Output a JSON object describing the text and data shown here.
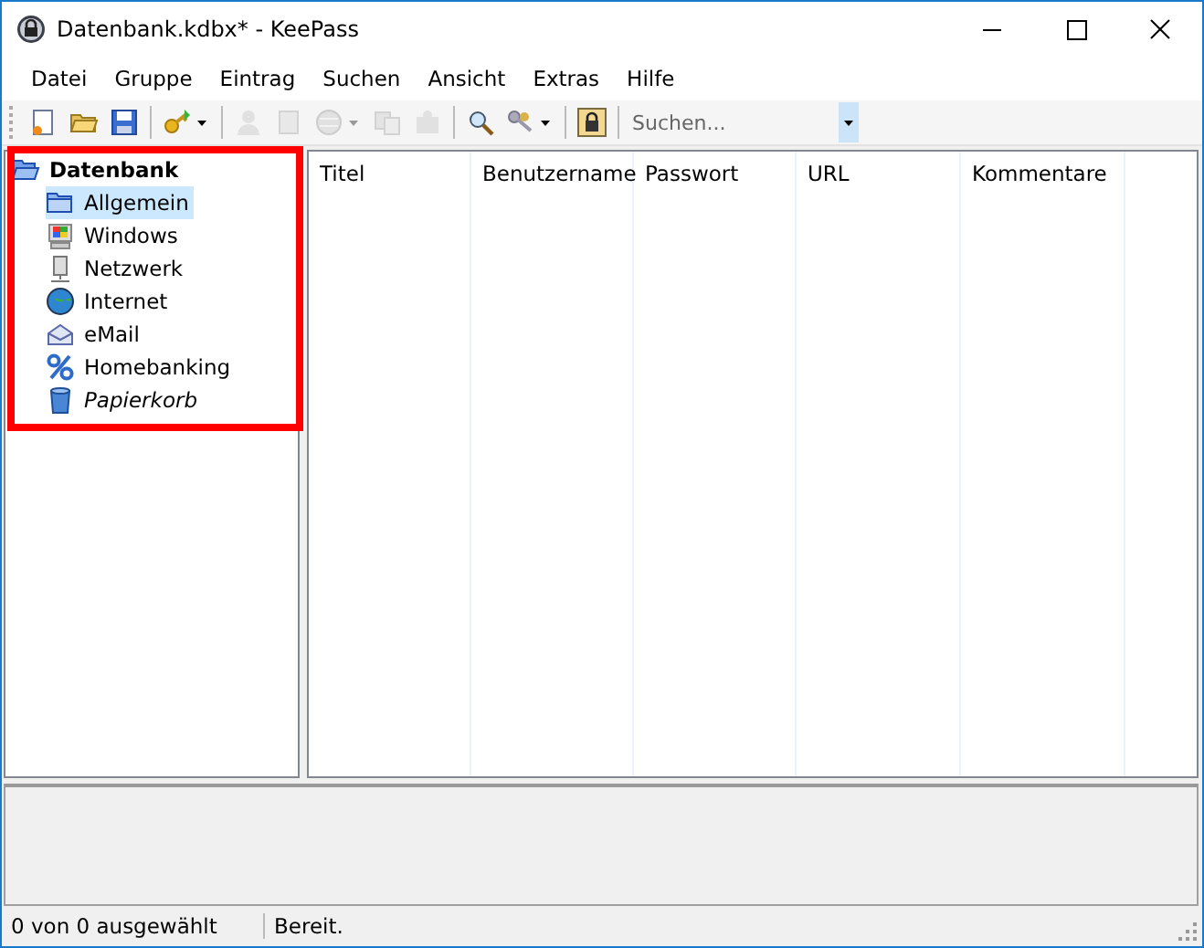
{
  "window": {
    "title": "Datenbank.kdbx* - KeePass"
  },
  "menu": [
    "Datei",
    "Gruppe",
    "Eintrag",
    "Suchen",
    "Ansicht",
    "Extras",
    "Hilfe"
  ],
  "toolbar": [
    {
      "kind": "new",
      "disabled": false
    },
    {
      "kind": "open",
      "disabled": false
    },
    {
      "kind": "save",
      "disabled": false
    },
    {
      "kind": "sep"
    },
    {
      "kind": "key",
      "disabled": false,
      "dropdown": true
    },
    {
      "kind": "sep"
    },
    {
      "kind": "person",
      "disabled": true
    },
    {
      "kind": "edit",
      "disabled": true
    },
    {
      "kind": "globe",
      "disabled": true,
      "dropdown": true
    },
    {
      "kind": "copy",
      "disabled": true
    },
    {
      "kind": "puzzle",
      "disabled": true
    },
    {
      "kind": "sep"
    },
    {
      "kind": "search",
      "disabled": false
    },
    {
      "kind": "keys",
      "disabled": false,
      "dropdown": true
    },
    {
      "kind": "sep"
    },
    {
      "kind": "lock",
      "disabled": false
    },
    {
      "kind": "sep"
    }
  ],
  "search": {
    "placeholder": "Suchen..."
  },
  "tree": {
    "label": "Datenbank",
    "selected": false,
    "children": [
      {
        "label": "Allgemein",
        "kind": "folder",
        "selected": true
      },
      {
        "label": "Windows",
        "kind": "windows",
        "selected": false
      },
      {
        "label": "Netzwerk",
        "kind": "network",
        "selected": false
      },
      {
        "label": "Internet",
        "kind": "globe",
        "selected": false
      },
      {
        "label": "eMail",
        "kind": "mail",
        "selected": false
      },
      {
        "label": "Homebanking",
        "kind": "percent",
        "selected": false
      },
      {
        "label": "Papierkorb",
        "kind": "trash",
        "selected": false
      }
    ]
  },
  "table": {
    "columns": [
      "Titel",
      "Benutzername",
      "Passwort",
      "URL",
      "Kommentare"
    ]
  },
  "status_bar": [
    "0 von 0 ausgewählt",
    "Bereit."
  ]
}
